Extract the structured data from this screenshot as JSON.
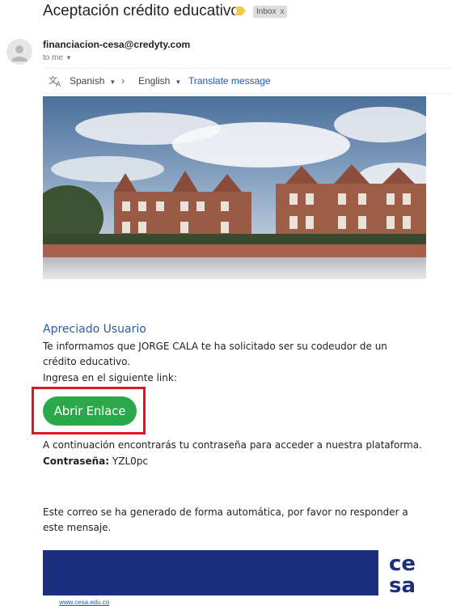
{
  "email": {
    "subject": "Aceptación crédito educativo",
    "label": "Inbox",
    "label_close": "x",
    "sender": "financiacion-cesa@credyty.com",
    "recipient": "to me",
    "icons": {
      "importance": "importance-marker-icon",
      "avatar": "person-avatar-icon",
      "translate": "translate-icon"
    }
  },
  "translate": {
    "from": "Spanish",
    "arrow": "›",
    "to": "English",
    "link": "Translate message"
  },
  "body": {
    "greeting": "Apreciado Usuario",
    "line1": "Te informamos que JORGE CALA te ha solicitado ser su codeudor de un crédito educativo.",
    "line2": "Ingresa en el siguiente link:",
    "button": "Abrir Enlace",
    "line3": "A continuación encontrarás tu contraseña para acceder a nuestra plataforma.",
    "password_label": "Contraseña:",
    "password_value": "YZL0pc",
    "footer_note": "Este correo se ha generado de forma automática, por favor no responder a este mensaje.",
    "site": "www.cesa.edu.co",
    "logo_text": [
      "ce",
      "sa"
    ]
  },
  "colors": {
    "button": "#2ba84a",
    "highlight": "#e0141e",
    "greeting": "#2a5aa8",
    "footer_band": "#1b2f7e",
    "link": "#1a57c5"
  }
}
